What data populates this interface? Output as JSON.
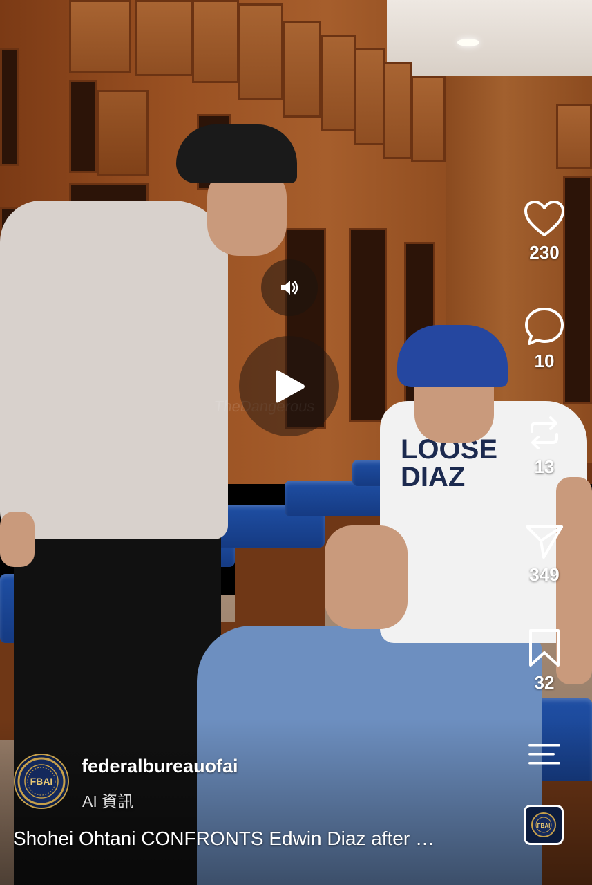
{
  "video": {
    "watermark_text": "TheDangerous"
  },
  "actions": {
    "like_count": "230",
    "comment_count": "10",
    "repost_count": "13",
    "share_count": "349",
    "save_count": "32"
  },
  "post": {
    "username": "federalbureauofai",
    "subtitle": "AI 資訊",
    "caption": "Shohei Ohtani CONFRONTS Edwin Diaz after …",
    "avatar_text": "FBAI"
  },
  "shirt_text": {
    "line1": "LOOSE",
    "line2": "DIAZ"
  },
  "colors": {
    "overlay_text": "#ffffff",
    "accent_gold": "#c7a04a",
    "bench_blue": "#1f4fa4"
  },
  "icons": {
    "like": "heart-icon",
    "comment": "comment-bubble-icon",
    "repost": "repost-icon",
    "share": "send-icon",
    "save": "bookmark-icon",
    "menu": "menu-icon",
    "mute": "speaker-icon",
    "play": "play-icon"
  }
}
